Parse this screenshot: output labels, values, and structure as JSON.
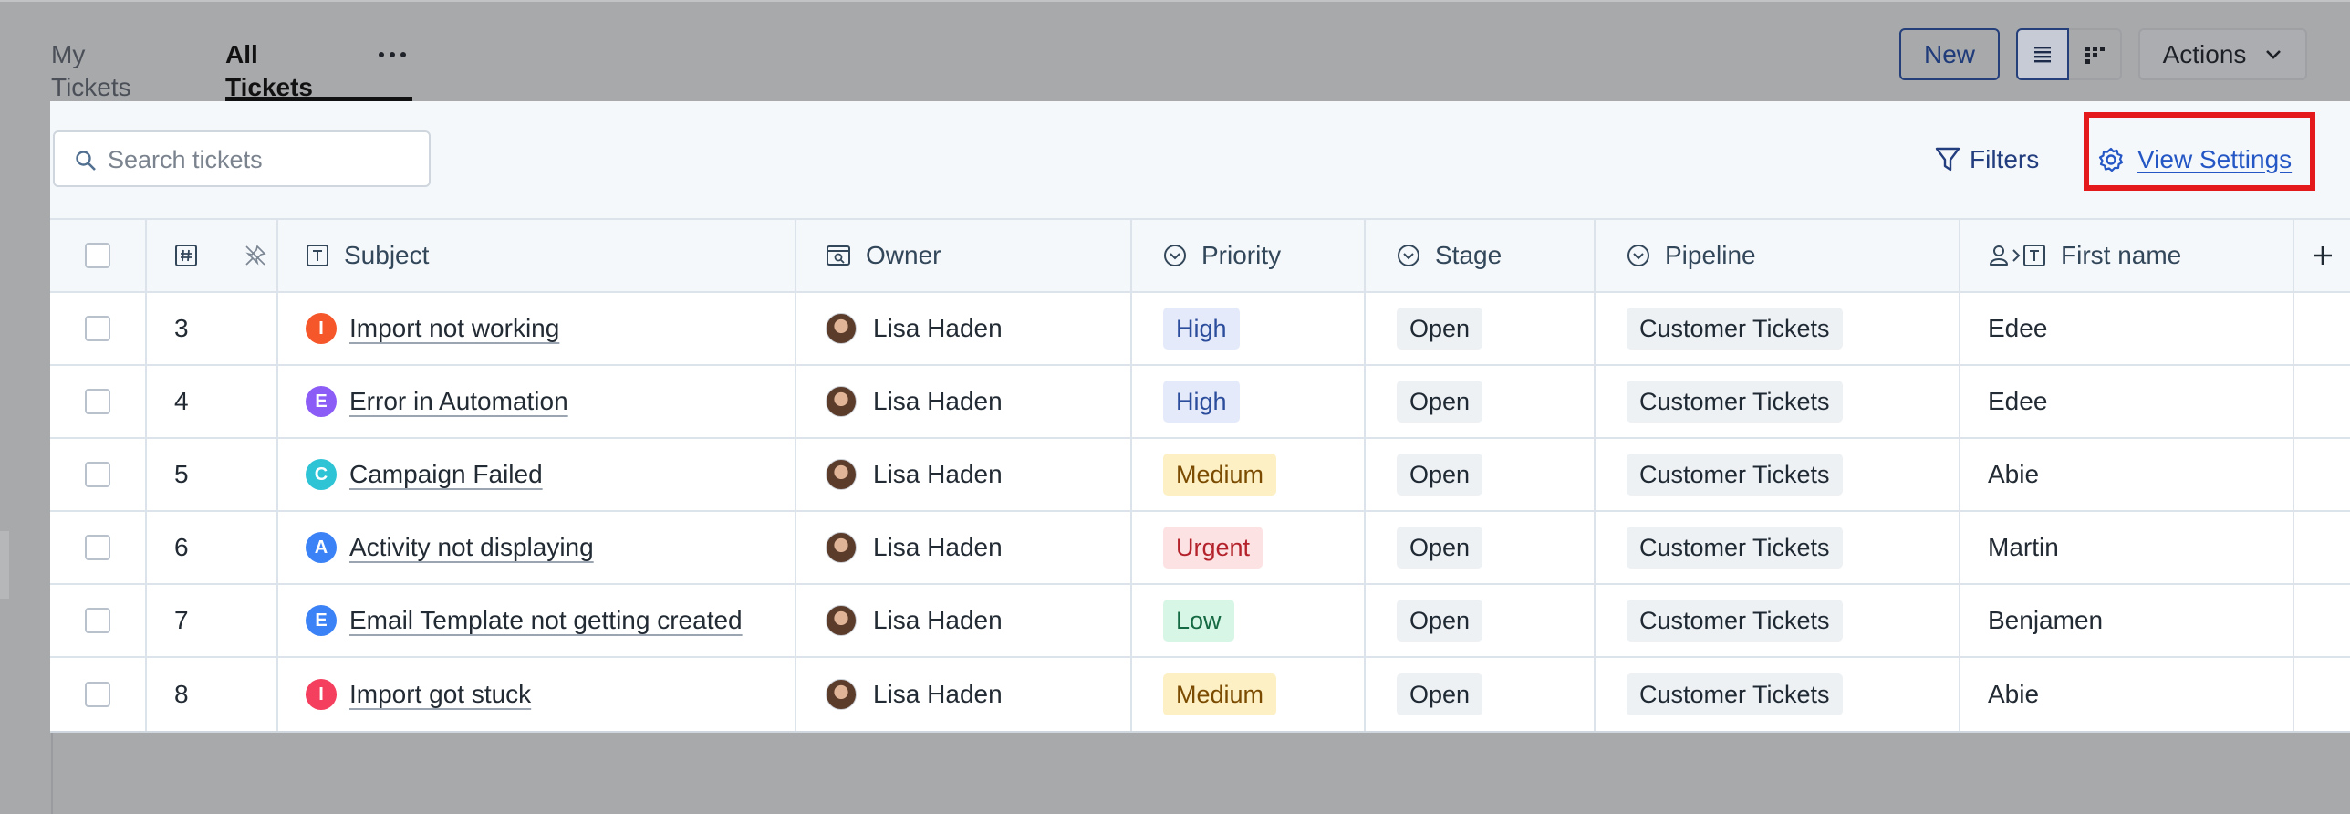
{
  "tabs": [
    {
      "label": "My Tickets",
      "active": false
    },
    {
      "label": "All Tickets",
      "active": true
    }
  ],
  "toolbar": {
    "new_label": "New",
    "actions_label": "Actions",
    "view_mode": "list"
  },
  "search": {
    "placeholder": "Search tickets",
    "value": ""
  },
  "filters_label": "Filters",
  "view_settings_label": "View Settings",
  "highlight_color": "#e3191c",
  "columns": {
    "id": "",
    "subject": "Subject",
    "owner": "Owner",
    "priority": "Priority",
    "stage": "Stage",
    "pipeline": "Pipeline",
    "first_name": "First name",
    "add": "+"
  },
  "priority_colors": {
    "High": {
      "bg": "#e4eaf9",
      "fg": "#2b4d9c"
    },
    "Medium": {
      "bg": "#fdf0c5",
      "fg": "#7a4b00"
    },
    "Urgent": {
      "bg": "#fde2e4",
      "fg": "#b4232c"
    },
    "Low": {
      "bg": "#d8f6e6",
      "fg": "#166a43"
    }
  },
  "rows": [
    {
      "id": "3",
      "letter": "I",
      "letter_color": "#f5562a",
      "subject": "Import not working",
      "owner": "Lisa Haden",
      "priority": "High",
      "stage": "Open",
      "pipeline": "Customer Tickets",
      "first_name": "Edee"
    },
    {
      "id": "4",
      "letter": "E",
      "letter_color": "#8b5cf6",
      "subject": "Error in Automation",
      "owner": "Lisa Haden",
      "priority": "High",
      "stage": "Open",
      "pipeline": "Customer Tickets",
      "first_name": "Edee"
    },
    {
      "id": "5",
      "letter": "C",
      "letter_color": "#2ec4d6",
      "subject": "Campaign Failed",
      "owner": "Lisa Haden",
      "priority": "Medium",
      "stage": "Open",
      "pipeline": "Customer Tickets",
      "first_name": "Abie"
    },
    {
      "id": "6",
      "letter": "A",
      "letter_color": "#3b82f6",
      "subject": "Activity not displaying",
      "owner": "Lisa Haden",
      "priority": "Urgent",
      "stage": "Open",
      "pipeline": "Customer Tickets",
      "first_name": "Martin"
    },
    {
      "id": "7",
      "letter": "E",
      "letter_color": "#3b82f6",
      "subject": "Email Template not getting created",
      "owner": "Lisa Haden",
      "priority": "Low",
      "stage": "Open",
      "pipeline": "Customer Tickets",
      "first_name": "Benjamen"
    },
    {
      "id": "8",
      "letter": "I",
      "letter_color": "#f43f5e",
      "subject": "Import got stuck",
      "owner": "Lisa Haden",
      "priority": "Medium",
      "stage": "Open",
      "pipeline": "Customer Tickets",
      "first_name": "Abie"
    }
  ]
}
